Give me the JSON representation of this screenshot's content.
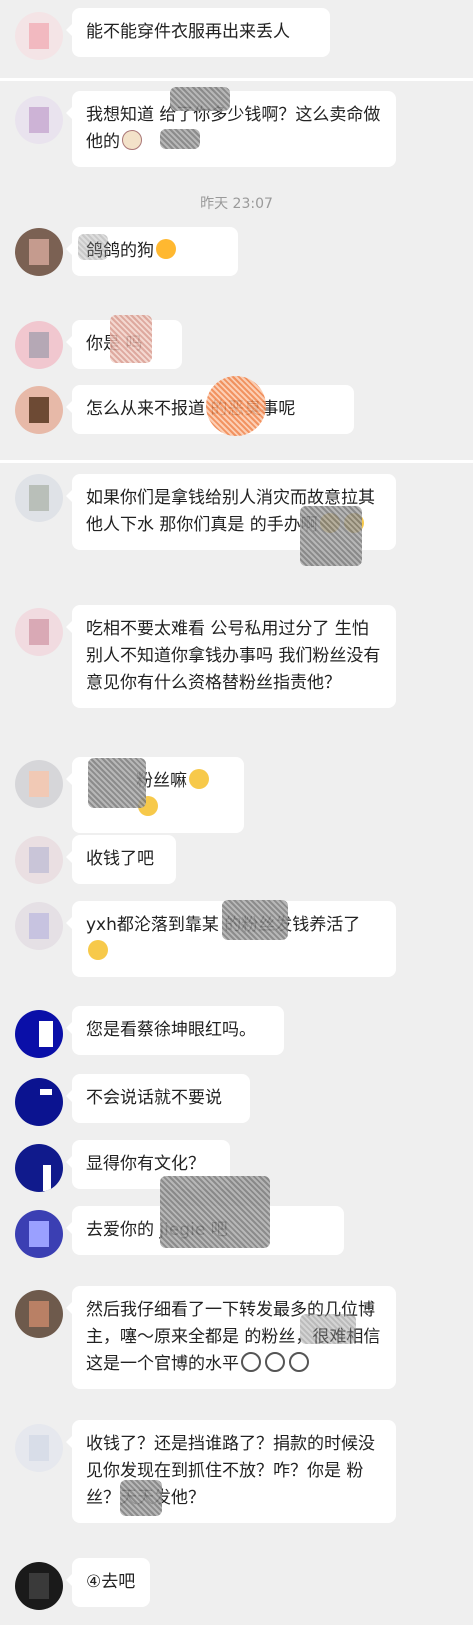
{
  "timestamp": "昨天 23:07",
  "messages": [
    {
      "text": "能不能穿件衣服再出来丢人",
      "avatar_color": "#f2e2e4"
    },
    {
      "text": "我想知道  给了你多少钱啊？这么卖命做他的",
      "avatar_color": "#e9e3ee"
    },
    {
      "text": "鸽鸽的狗",
      "avatar_color": "#7b6153"
    },
    {
      "text": "你是  吗",
      "avatar_color": "#f1c7cf"
    },
    {
      "text": "怎么从来不报道  的恶臭事呢",
      "avatar_color": "#e7b9a8"
    },
    {
      "text": "如果你们是拿钱给别人消灾而故意拉其他人下水 那你们真是  的手办啊",
      "avatar_color": "#dfe2e7"
    },
    {
      "text": "吃相不要太难看 公号私用过分了 生怕别人不知道你拿钱办事吗 我们粉丝没有意见你有什么资格替粉丝指责他？",
      "avatar_color": "#f1dbe0"
    },
    {
      "text": "粉丝嘛",
      "avatar_color": "#d6d6d9"
    },
    {
      "text": "收钱了吧",
      "avatar_color": "#eadfe2"
    },
    {
      "text": "yxh都沦落到靠某  的粉丝发钱养活了",
      "avatar_color": "#e5e0e5"
    },
    {
      "text": "您是看蔡徐坤眼红吗。",
      "avatar_color": "#0a0fa8"
    },
    {
      "text": "不会说话就不要说",
      "avatar_color": "#0b1390"
    },
    {
      "text": "显得你有文化？",
      "avatar_color": "#101a8c"
    },
    {
      "text": "去爱你的  jiegie 吧",
      "avatar_color": "#3b3fb3"
    },
    {
      "text": "然后我仔细看了一下转发最多的几位博主，噻～原来全都是  的粉丝，很难相信这是一个官博的水平",
      "avatar_color": "#6e5a4c"
    },
    {
      "text": "收钱了？还是挡谁路了？捐款的时候没见你发现在到抓住不放？咋？你是  粉丝？天天发他？",
      "avatar_color": "#e6e8ee"
    },
    {
      "text": "④去吧",
      "avatar_color": "#1a1a1a"
    }
  ]
}
